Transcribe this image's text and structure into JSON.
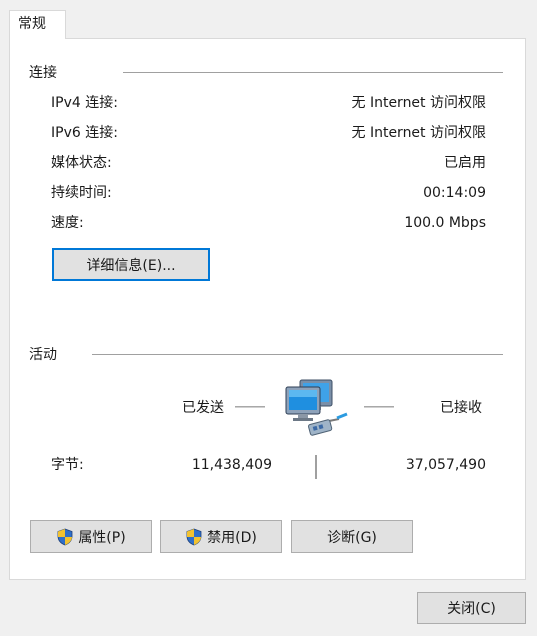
{
  "tab": {
    "label": "常规"
  },
  "connection": {
    "title": "连接",
    "rows": [
      {
        "label": "IPv4 连接:",
        "value": "无 Internet 访问权限"
      },
      {
        "label": "IPv6 连接:",
        "value": "无 Internet 访问权限"
      },
      {
        "label": "媒体状态:",
        "value": "已启用"
      },
      {
        "label": "持续时间:",
        "value": "00:14:09"
      },
      {
        "label": "速度:",
        "value": "100.0 Mbps"
      }
    ],
    "details_button": "详细信息(E)..."
  },
  "activity": {
    "title": "活动",
    "sent_label": "已发送",
    "received_label": "已接收",
    "bytes_label": "字节:",
    "bytes_sent": "11,438,409",
    "bytes_received": "37,057,490"
  },
  "buttons": {
    "properties": "属性(P)",
    "disable": "禁用(D)",
    "diagnose": "诊断(G)",
    "close": "关闭(C)"
  },
  "icons": {
    "network": "network-computers-icon",
    "shield": "uac-shield-icon"
  },
  "colors": {
    "focus_border": "#0078d7",
    "button_bg": "#e1e1e1"
  }
}
